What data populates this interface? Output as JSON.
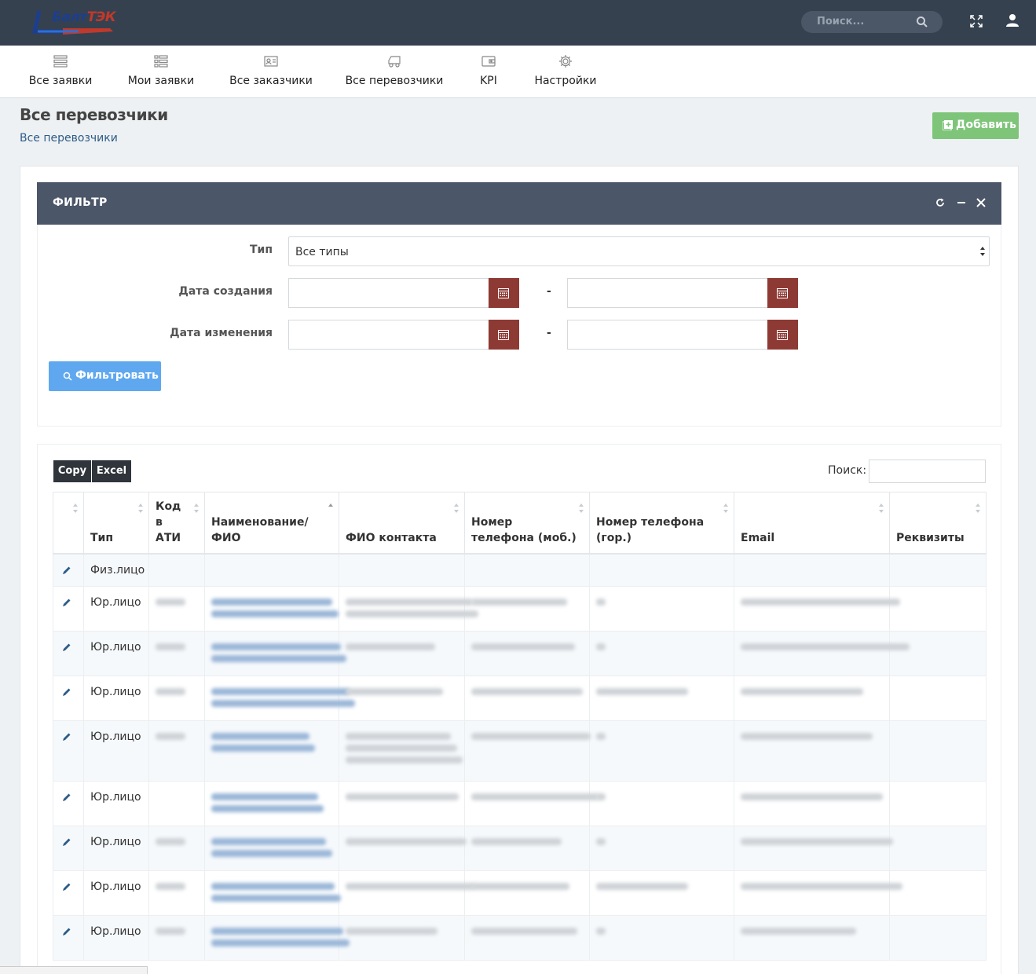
{
  "brand": {
    "logo_text_a": "Балт",
    "logo_text_b": "ТЭК"
  },
  "topbar": {
    "search_placeholder": "Поиск..."
  },
  "nav": {
    "items": [
      {
        "label": "Все заявки",
        "icon": "list-icon"
      },
      {
        "label": "Мои заявки",
        "icon": "list-check-icon"
      },
      {
        "label": "Все заказчики",
        "icon": "id-card-icon"
      },
      {
        "label": "Все перевозчики",
        "icon": "truck-icon"
      },
      {
        "label": "KPI",
        "icon": "wallet-icon"
      },
      {
        "label": "Настройки",
        "icon": "gear-icon"
      }
    ]
  },
  "page": {
    "title": "Все перевозчики",
    "breadcrumb": "Все перевозчики",
    "add_label": "Добавить"
  },
  "filter": {
    "title": "ФИЛЬТР",
    "type_label": "Тип",
    "type_value": "Все типы",
    "created_label": "Дата создания",
    "modified_label": "Дата изменения",
    "range_dash": "-",
    "submit_label": "Фильтровать"
  },
  "table": {
    "copy_label": "Copy",
    "excel_label": "Excel",
    "search_label": "Поиск:",
    "headers": {
      "type": "Тип",
      "ati_1": "Код",
      "ati_2": "в",
      "ati_3": "АТИ",
      "name_1": "Наименование/",
      "name_2": "ФИО",
      "contact": "ФИО контакта",
      "mobile_1": "Номер",
      "mobile_2": "телефона (моб.)",
      "landline_1": "Номер телефона",
      "landline_2": "(гор.)",
      "email": "Email",
      "requisites": "Реквизиты"
    },
    "rows": [
      {
        "type": "Физ.лицо"
      },
      {
        "type": "Юр.лицо"
      },
      {
        "type": "Юр.лицо"
      },
      {
        "type": "Юр.лицо"
      },
      {
        "type": "Юр.лицо"
      },
      {
        "type": "Юр.лицо"
      },
      {
        "type": "Юр.лицо"
      },
      {
        "type": "Юр.лицо"
      },
      {
        "type": "Юр.лицо"
      }
    ]
  },
  "colors": {
    "topbar": "#364150",
    "add_button": "#7ec57a",
    "calendar_button": "#8e3a34",
    "filter_button": "#5fa8ef",
    "filter_header": "#4b5668"
  }
}
